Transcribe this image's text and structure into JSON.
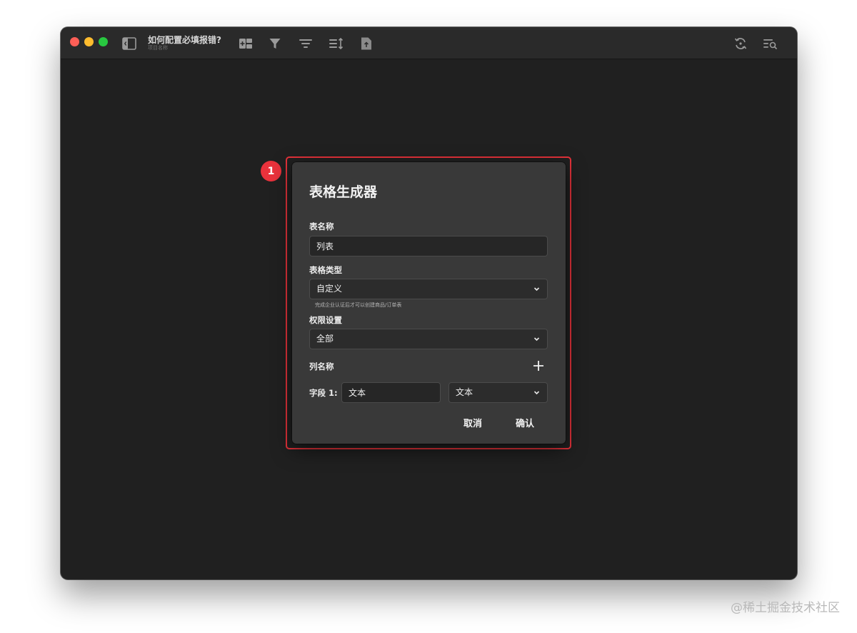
{
  "window": {
    "title": "如何配置必填报错?",
    "subtitle": "项目名称"
  },
  "toolbar": {
    "left_icons": [
      "sidebar-toggle-icon",
      "add-column-icon",
      "filter-icon",
      "list-filter-icon",
      "sort-icon",
      "export-icon"
    ],
    "right_icons": [
      "sync-icon",
      "search-list-icon"
    ]
  },
  "annotation": {
    "step_number": "1",
    "highlight_color": "#e5323a"
  },
  "dialog": {
    "title": "表格生成器",
    "table_name_label": "表名称",
    "table_name_value": "列表",
    "table_type_label": "表格类型",
    "table_type_value": "自定义",
    "table_type_hint": "完成企业认证后才可以创建商品/订单表",
    "permission_label": "权限设置",
    "permission_value": "全部",
    "columns_label": "列名称",
    "field_rows": [
      {
        "label": "字段 1:",
        "name_value": "文本",
        "type_value": "文本"
      }
    ],
    "cancel_label": "取消",
    "confirm_label": "确认"
  },
  "watermark": "@稀土掘金技术社区",
  "colors": {
    "window_bg": "#202020",
    "titlebar_bg": "#2a2a2a",
    "dialog_bg": "#393939",
    "input_bg": "#262626",
    "badge_red": "#e9323c",
    "traffic_close": "#fe5f57",
    "traffic_minimize": "#febc2e",
    "traffic_maximize": "#28c840"
  }
}
